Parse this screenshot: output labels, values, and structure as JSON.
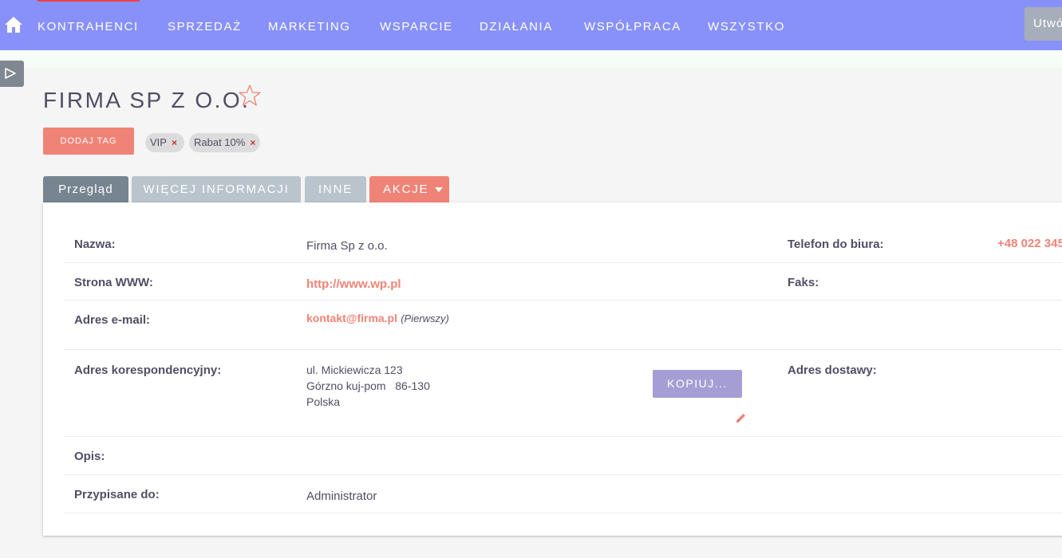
{
  "nav": {
    "items": [
      {
        "label": "KONTRAHENCI"
      },
      {
        "label": "SPRZEDAŻ"
      },
      {
        "label": "MARKETING"
      },
      {
        "label": "WSPARCIE"
      },
      {
        "label": "DZIAŁANIA"
      },
      {
        "label": "WSPÓŁPRACA"
      },
      {
        "label": "WSZYSTKO"
      }
    ],
    "create_label": "Utwó",
    "home_icon": "home-icon",
    "accent_color": "#f0433f",
    "bar_color": "#8891f9"
  },
  "sidebar": {
    "toggle_icon": "play-triangle-icon"
  },
  "record": {
    "title": "FIRMA SP Z O.O.",
    "favorite_icon": "star-outline-icon"
  },
  "tags": {
    "add_label": "DODAJ TAG",
    "items": [
      {
        "label": "VIP",
        "remove": "×"
      },
      {
        "label": "Rabat 10%",
        "remove": "×"
      }
    ]
  },
  "tabs": {
    "overview": "Przegląd",
    "more": "WIĘCEJ INFORMACJI",
    "other": "INNE",
    "actions": "AKCJE"
  },
  "fields": {
    "name_label": "Nazwa:",
    "name_value": "Firma Sp z o.o.",
    "phone_label": "Telefon do biura:",
    "phone_value": "+48 022 345",
    "website_label": "Strona WWW:",
    "website_value": "http://www.wp.pl",
    "fax_label": "Faks:",
    "email_label": "Adres e-mail:",
    "email_value": "kontakt@firma.pl",
    "email_note": "(Pierwszy)",
    "address_label": "Adres korespondencyjny:",
    "address_lines": [
      "ul. Mickiewicza 123",
      "Górzno kuj-pom   86-130",
      "Polska"
    ],
    "copy_label": "KOPIUJ...",
    "shipping_label": "Adres dostawy:",
    "description_label": "Opis:",
    "assigned_label": "Przypisane do:",
    "assigned_value": "Administrator"
  }
}
